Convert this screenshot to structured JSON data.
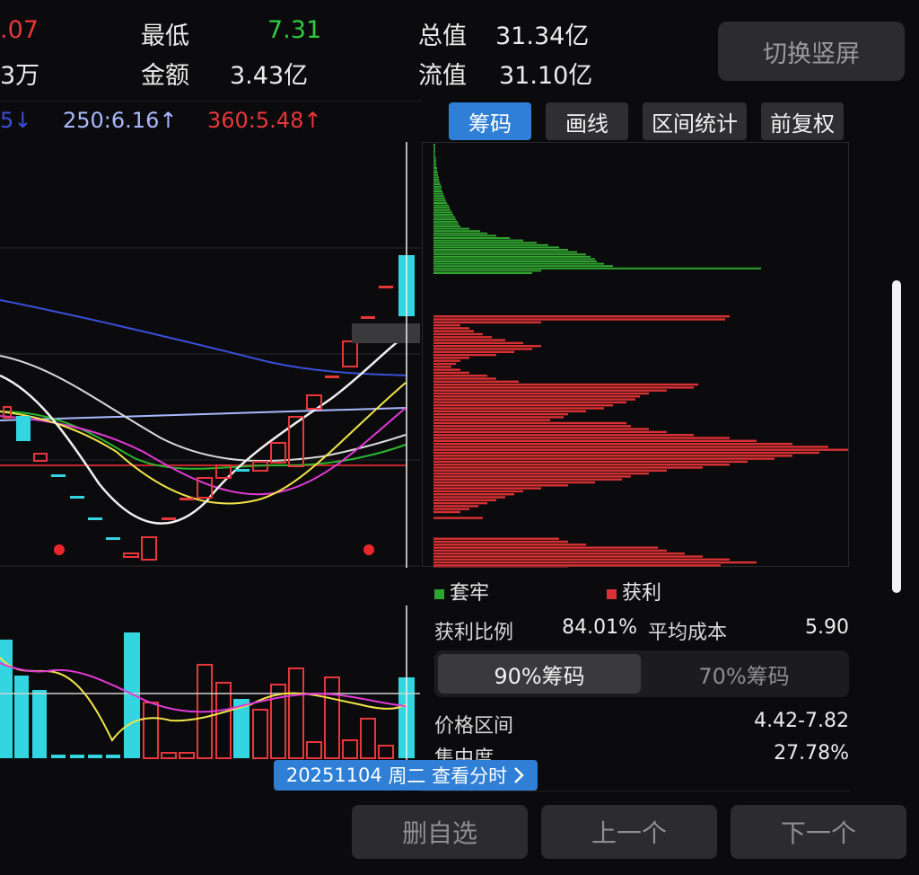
{
  "header": {
    "partial_price": ".07",
    "partial_volume": "3万",
    "low_label": "最低",
    "low_value": "7.31",
    "amount_label": "金额",
    "amount_value": "3.43亿",
    "total_cap_label": "总值",
    "total_cap_value": "31.34亿",
    "float_cap_label": "流值",
    "float_cap_value": "31.10亿",
    "switch_button": "切换竖屏"
  },
  "ma_line": {
    "partial": "5↓",
    "ma250": "250:6.16↑",
    "ma360": "360:5.48↑"
  },
  "tabs": [
    {
      "label": "筹码",
      "active": true
    },
    {
      "label": "画线",
      "active": false
    },
    {
      "label": "区间统计",
      "active": false
    },
    {
      "label": "前复权",
      "active": false
    }
  ],
  "chip_panel": {
    "legend_trapped": "套牢",
    "legend_profit": "获利",
    "profit_ratio_label": "获利比例",
    "profit_ratio_value": "84.01%",
    "avg_cost_label": "平均成本",
    "avg_cost_value": "5.90",
    "segment_90": "90%筹码",
    "segment_70": "70%筹码",
    "segment_active": "90%筹码",
    "price_range_label": "价格区间",
    "price_range_value": "4.42-7.82",
    "concentration_label": "集中度",
    "concentration_value": "27.78%",
    "colors": {
      "trapped": "#2fa52f",
      "profit": "#d93033"
    }
  },
  "date_tip": {
    "date": "20251104",
    "weekday": "周二",
    "action": "查看分时"
  },
  "bottom_buttons": {
    "delete_watch": "删自选",
    "prev": "上一个",
    "next": "下一个"
  },
  "colors": {
    "up": "#e8363b",
    "down": "#33d6e0",
    "accent": "#2f7fd6",
    "ma250": "#a9b8ff",
    "ma_blue": "#3a4fd8"
  }
}
